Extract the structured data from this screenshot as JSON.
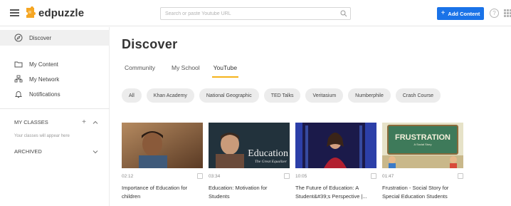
{
  "topbar": {
    "brand": "edpuzzle",
    "search_placeholder": "Search or paste Youtube URL",
    "add_content_label": "Add Content",
    "help_glyph": "?"
  },
  "sidebar": {
    "items": [
      {
        "label": "Discover",
        "icon": "compass-icon",
        "active": true
      },
      {
        "label": "My Content",
        "icon": "folder-icon"
      },
      {
        "label": "My Network",
        "icon": "network-icon"
      },
      {
        "label": "Notifications",
        "icon": "bell-icon"
      }
    ],
    "classes_title": "MY CLASSES",
    "classes_empty": "Your classes will appear here",
    "archived_label": "ARCHIVED"
  },
  "main": {
    "title": "Discover",
    "tabs": [
      {
        "label": "Community",
        "active": false
      },
      {
        "label": "My School",
        "active": false
      },
      {
        "label": "YouTube",
        "active": true
      }
    ],
    "chips": [
      "All",
      "Khan Academy",
      "National Geographic",
      "TED Talks",
      "Veritasium",
      "Numberphile",
      "Crash Course"
    ],
    "videos": [
      {
        "duration": "02:12",
        "title": "Importance of Education for children"
      },
      {
        "duration": "03:34",
        "title": "Education: Motivation for Students"
      },
      {
        "duration": "10:05",
        "title": "The Future of Education: A Student&#39;s Perspective |..."
      },
      {
        "duration": "01:47",
        "title": "Frustration - Social Story for Special Education Students"
      }
    ],
    "thumb_texts": {
      "education": "Education",
      "education_sub": "The Great Equalizer",
      "frustration": "FRUSTRATION",
      "frustration_sub": "A Social Story"
    }
  },
  "colors": {
    "accent_blue": "#1a73e8",
    "tab_underline": "#f5b31b",
    "logo_orange": "#f5a623"
  }
}
